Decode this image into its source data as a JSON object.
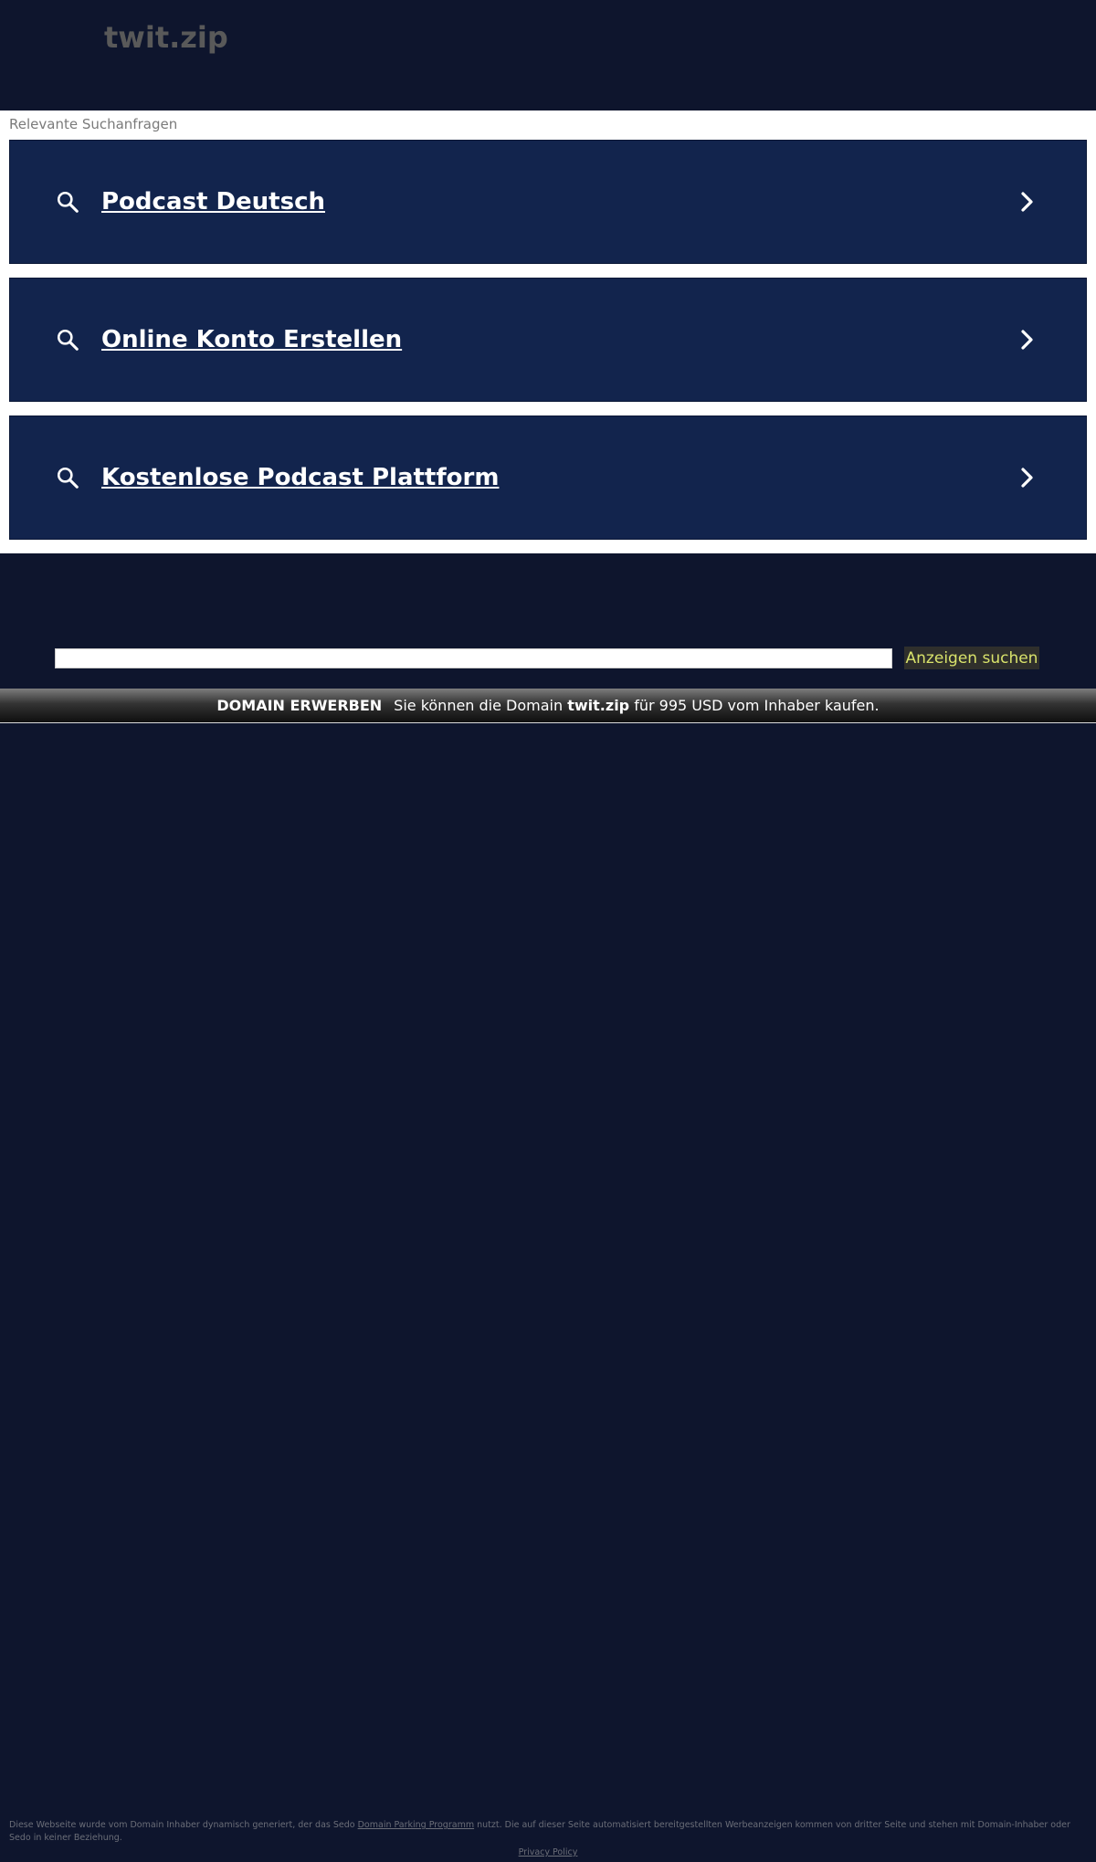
{
  "header": {
    "site_title": "twit.zip"
  },
  "related": {
    "title": "Relevante Suchanfragen",
    "items": [
      {
        "label": "Podcast Deutsch"
      },
      {
        "label": "Online Konto Erstellen"
      },
      {
        "label": "Kostenlose Podcast Plattform"
      }
    ]
  },
  "search": {
    "input_value": "",
    "button_label": "Anzeigen suchen"
  },
  "banner": {
    "buy_label": "DOMAIN ERWERBEN",
    "text_before": "Sie können die Domain",
    "domain": "twit.zip",
    "text_after": "für 995 USD vom Inhaber kaufen."
  },
  "footer": {
    "text_before": "Diese Webseite wurde vom Domain Inhaber dynamisch generiert, der das Sedo",
    "link_label": "Domain Parking Programm",
    "text_after": "nutzt. Die auf dieser Seite automatisiert bereitgestellten Werbeanzeigen kommen von dritter Seite und stehen mit Domain-Inhaber oder Sedo in keiner Beziehung.",
    "privacy_label": "Privacy Policy"
  },
  "colors": {
    "background": "#0e152d",
    "card": "#12244d",
    "search_button_text": "#d9e36b"
  },
  "icons": {
    "search": "search-icon",
    "chevron": "chevron-right-icon"
  }
}
